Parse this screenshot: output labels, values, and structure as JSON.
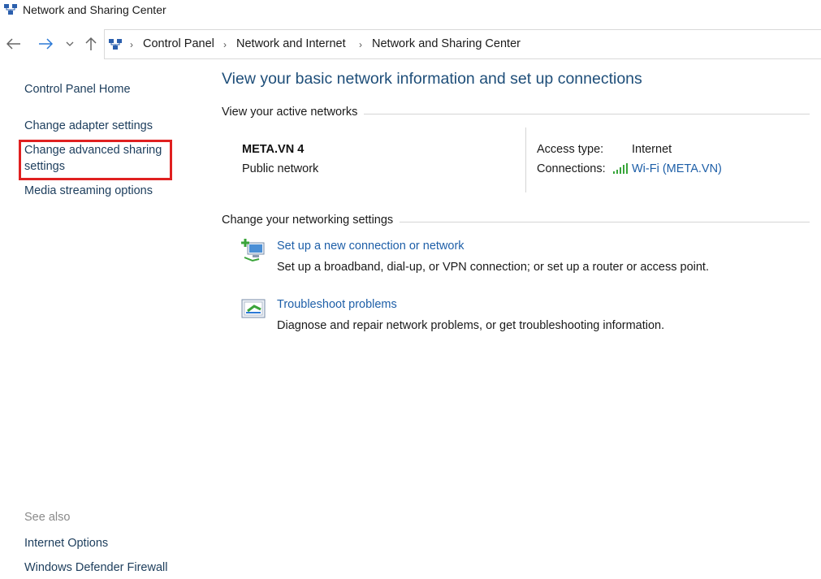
{
  "window": {
    "title": "Network and Sharing Center",
    "icon": "network-sharing-icon"
  },
  "nav": {
    "back_icon": "back-arrow-icon",
    "forward_icon": "forward-arrow-icon",
    "recent_icon": "chevron-down-icon",
    "up_icon": "up-arrow-icon"
  },
  "breadcrumb": [
    "Control Panel",
    "Network and Internet",
    "Network and Sharing Center"
  ],
  "sidebar": {
    "items": [
      {
        "label": "Control Panel Home"
      },
      {
        "label": "Change adapter settings"
      },
      {
        "label": "Change advanced sharing",
        "label2": "settings",
        "highlighted": true
      },
      {
        "label": "Media streaming options"
      }
    ],
    "see_also_label": "See also",
    "see_also": [
      {
        "label": "Internet Options"
      },
      {
        "label": "Windows Defender Firewall"
      }
    ]
  },
  "main": {
    "title": "View your basic network information and set up connections",
    "active_networks": {
      "header": "View your active networks",
      "name": "META.VN 4",
      "type": "Public network",
      "access_type_label": "Access type:",
      "access_type_value": "Internet",
      "connections_label": "Connections:",
      "connection_link": "Wi-Fi (META.VN)"
    },
    "settings": {
      "header": "Change your networking settings",
      "tasks": [
        {
          "icon": "new-connection-icon",
          "link": "Set up a new connection or network",
          "description": "Set up a broadband, dial-up, or VPN connection; or set up a router or access point."
        },
        {
          "icon": "troubleshoot-icon",
          "link": "Troubleshoot problems",
          "description": "Diagnose and repair network problems, or get troubleshooting information."
        }
      ]
    }
  },
  "colors": {
    "link": "#1e5fa8",
    "title": "#1e4e79",
    "highlight": "#e02020"
  }
}
